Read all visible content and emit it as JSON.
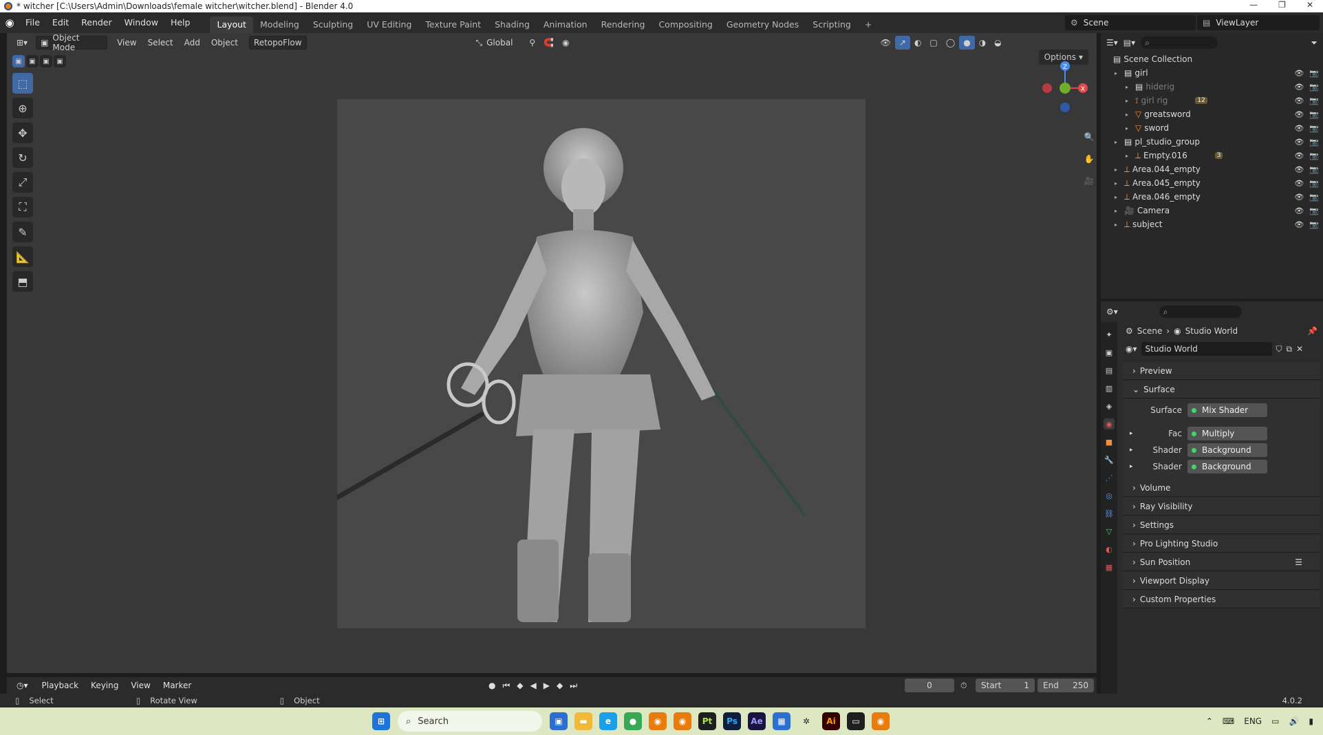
{
  "window": {
    "title": "* witcher [C:\\Users\\Admin\\Downloads\\female witcher\\witcher.blend] - Blender 4.0"
  },
  "menu": [
    "File",
    "Edit",
    "Render",
    "Window",
    "Help"
  ],
  "workspaces": [
    "Layout",
    "Modeling",
    "Sculpting",
    "UV Editing",
    "Texture Paint",
    "Shading",
    "Animation",
    "Rendering",
    "Compositing",
    "Geometry Nodes",
    "Scripting"
  ],
  "workspace_add": "+",
  "scene": {
    "name": "Scene",
    "view_layer": "ViewLayer"
  },
  "viewport": {
    "mode": "Object Mode",
    "menus": [
      "View",
      "Select",
      "Add",
      "Object"
    ],
    "addon_menu": "RetopoFlow",
    "transform_orientation": "Global",
    "options": "Options",
    "gizmo_axes": {
      "z": "Z",
      "x": "X"
    }
  },
  "timeline": {
    "menus": [
      "Playback",
      "Keying",
      "View",
      "Marker"
    ],
    "current_frame": "0",
    "start_label": "Start",
    "start": "1",
    "end_label": "End",
    "end": "250"
  },
  "status": {
    "select": "Select",
    "rotate": "Rotate View",
    "object": "Object",
    "version": "4.0.2"
  },
  "outliner": {
    "root": "Scene Collection",
    "rows": [
      {
        "name": "girl",
        "level": 0
      },
      {
        "name": "hiderig",
        "level": 1
      },
      {
        "name": "girl rig",
        "level": 1,
        "badge": "12"
      },
      {
        "name": "greatsword",
        "level": 1
      },
      {
        "name": "sword",
        "level": 1
      },
      {
        "name": "pl_studio_group",
        "level": 0
      },
      {
        "name": "Empty.016",
        "level": 1,
        "badge": "3"
      },
      {
        "name": "Area.044_empty",
        "level": 0
      },
      {
        "name": "Area.045_empty",
        "level": 0
      },
      {
        "name": "Area.046_empty",
        "level": 0
      },
      {
        "name": "Camera",
        "level": 0
      },
      {
        "name": "subject",
        "level": 0
      }
    ]
  },
  "properties": {
    "breadcrumb_scene": "Scene",
    "breadcrumb_world": "Studio World",
    "world_name": "Studio World",
    "panels": {
      "preview": "Preview",
      "surface": "Surface",
      "volume": "Volume",
      "ray_visibility": "Ray Visibility",
      "settings": "Settings",
      "pro_lighting": "Pro Lighting Studio",
      "sun_position": "Sun Position",
      "viewport_display": "Viewport Display",
      "custom_props": "Custom Properties"
    },
    "surface_fields": {
      "surface_label": "Surface",
      "surface_value": "Mix Shader",
      "fac_label": "Fac",
      "fac_value": "Multiply",
      "shader1_label": "Shader",
      "shader1_value": "Background",
      "shader2_label": "Shader",
      "shader2_value": "Background"
    }
  },
  "taskbar": {
    "search_placeholder": "Search",
    "language": "ENG"
  }
}
